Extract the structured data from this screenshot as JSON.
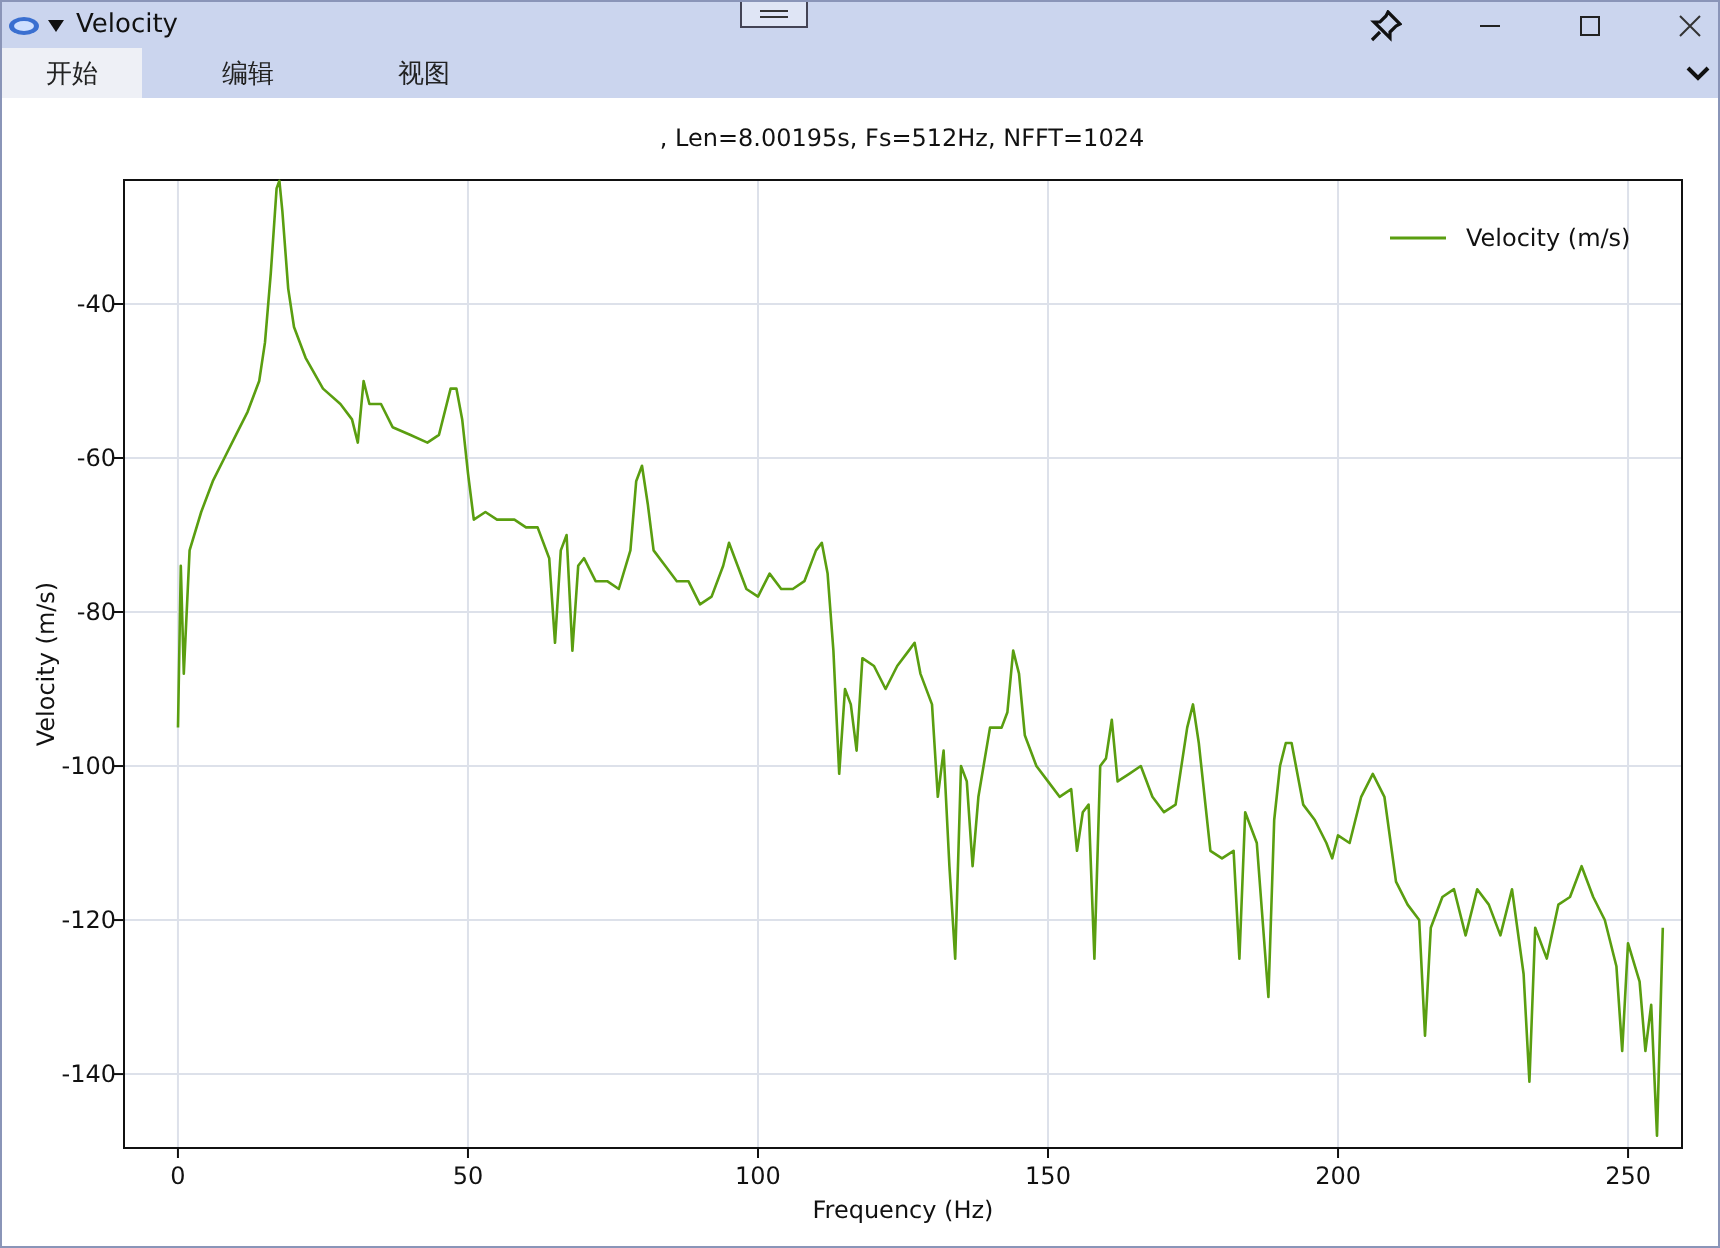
{
  "window": {
    "title": "Velocity"
  },
  "tabs": [
    {
      "label": "开始",
      "selected": true
    },
    {
      "label": "编辑",
      "selected": false
    },
    {
      "label": "视图",
      "selected": false
    }
  ],
  "chart": {
    "chart_data": {
      "type": "line",
      "title": ", Len=8.00195s, Fs=512Hz, NFFT=1024",
      "xlabel": "Frequency (Hz)",
      "ylabel": "Velocity (m/s)",
      "x": [
        0,
        0.5,
        1,
        2,
        4,
        6,
        8,
        10,
        12,
        14,
        15,
        16,
        17,
        17.5,
        18,
        19,
        20,
        22,
        25,
        28,
        30,
        31,
        32,
        33,
        35,
        37,
        40,
        43,
        45,
        47,
        48,
        49,
        50,
        51,
        53,
        55,
        58,
        60,
        62,
        64,
        65,
        66,
        67,
        68,
        69,
        70,
        72,
        74,
        76,
        78,
        79,
        80,
        81,
        82,
        84,
        86,
        88,
        90,
        92,
        94,
        95,
        96,
        98,
        100,
        102,
        104,
        106,
        108,
        110,
        111,
        112,
        113,
        114,
        115,
        116,
        117,
        118,
        120,
        122,
        124,
        126,
        127,
        128,
        130,
        131,
        132,
        133,
        134,
        135,
        136,
        137,
        138,
        140,
        142,
        143,
        144,
        145,
        146,
        148,
        150,
        152,
        154,
        155,
        156,
        157,
        158,
        159,
        160,
        161,
        162,
        164,
        166,
        168,
        170,
        172,
        174,
        175,
        176,
        178,
        180,
        182,
        183,
        184,
        186,
        188,
        189,
        190,
        191,
        192,
        194,
        196,
        198,
        199,
        200,
        202,
        204,
        206,
        208,
        210,
        212,
        214,
        215,
        216,
        218,
        220,
        222,
        224,
        226,
        228,
        230,
        232,
        233,
        234,
        236,
        238,
        240,
        242,
        244,
        246,
        248,
        249,
        250,
        252,
        253,
        254,
        255,
        256
      ],
      "series": [
        {
          "name": "Velocity (m/s)",
          "color": "#5a9e10",
          "values": [
            -95,
            -74,
            -88,
            -72,
            -67,
            -63,
            -60,
            -57,
            -54,
            -50,
            -45,
            -36,
            -25,
            -24,
            -28,
            -38,
            -43,
            -47,
            -51,
            -53,
            -55,
            -58,
            -50,
            -53,
            -53,
            -56,
            -57,
            -58,
            -57,
            -51,
            -51,
            -55,
            -62,
            -68,
            -67,
            -68,
            -68,
            -69,
            -69,
            -73,
            -84,
            -72,
            -70,
            -85,
            -74,
            -73,
            -76,
            -76,
            -77,
            -72,
            -63,
            -61,
            -66,
            -72,
            -74,
            -76,
            -76,
            -79,
            -78,
            -74,
            -71,
            -73,
            -77,
            -78,
            -75,
            -77,
            -77,
            -76,
            -72,
            -71,
            -75,
            -85,
            -101,
            -90,
            -92,
            -98,
            -86,
            -87,
            -90,
            -87,
            -85,
            -84,
            -88,
            -92,
            -104,
            -98,
            -113,
            -125,
            -100,
            -102,
            -113,
            -104,
            -95,
            -95,
            -93,
            -85,
            -88,
            -96,
            -100,
            -102,
            -104,
            -103,
            -111,
            -106,
            -105,
            -125,
            -100,
            -99,
            -94,
            -102,
            -101,
            -100,
            -104,
            -106,
            -105,
            -95,
            -92,
            -97,
            -111,
            -112,
            -111,
            -125,
            -106,
            -110,
            -130,
            -107,
            -100,
            -97,
            -97,
            -105,
            -107,
            -110,
            -112,
            -109,
            -110,
            -104,
            -101,
            -104,
            -115,
            -118,
            -120,
            -135,
            -121,
            -117,
            -116,
            -122,
            -116,
            -118,
            -122,
            -116,
            -127,
            -141,
            -121,
            -125,
            -118,
            -117,
            -113,
            -117,
            -120,
            -126,
            -137,
            -123,
            -128,
            -137,
            -131,
            -148,
            -121
          ]
        }
      ],
      "grid": true,
      "xlim": [
        -9.3,
        259.3
      ],
      "ylim": [
        -149.6,
        -23.9
      ],
      "xticks": [
        0,
        50,
        100,
        150,
        200,
        250
      ],
      "yticks": [
        -40,
        -60,
        -80,
        -100,
        -120,
        -140
      ]
    }
  }
}
